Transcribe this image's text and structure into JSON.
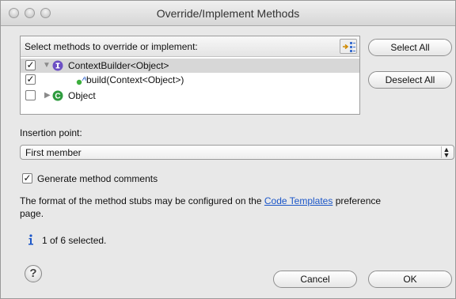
{
  "window": {
    "title": "Override/Implement Methods"
  },
  "methods_panel": {
    "header_label": "Select methods to override or implement:",
    "sort_icon": "sort-members-icon",
    "rows": [
      {
        "checked": true,
        "expanded": true,
        "icon": "interface-icon",
        "label": "ContextBuilder<Object>",
        "selected": true
      },
      {
        "checked": true,
        "icon": "abstract-method-icon",
        "label": "build(Context<Object>)"
      },
      {
        "checked": false,
        "expanded": false,
        "icon": "class-icon",
        "label": "Object"
      }
    ]
  },
  "buttons": {
    "select_all": "Select All",
    "deselect_all": "Deselect All",
    "cancel": "Cancel",
    "ok": "OK"
  },
  "insertion": {
    "label": "Insertion point:",
    "selected": "First member"
  },
  "generate_comments": {
    "checked": true,
    "label": "Generate method comments"
  },
  "info": {
    "prefix": "The format of the method stubs may be configured on the",
    "link": "Code Templates",
    "suffix_line1": "preference",
    "suffix_line2": "page."
  },
  "status": {
    "icon": "info-icon",
    "text": "1 of 6 selected."
  },
  "colors": {
    "link": "#1b56c8",
    "interface_icon": "#6c4fc4",
    "class_icon": "#2e9b3e",
    "method_icon": "#3cae3c"
  }
}
